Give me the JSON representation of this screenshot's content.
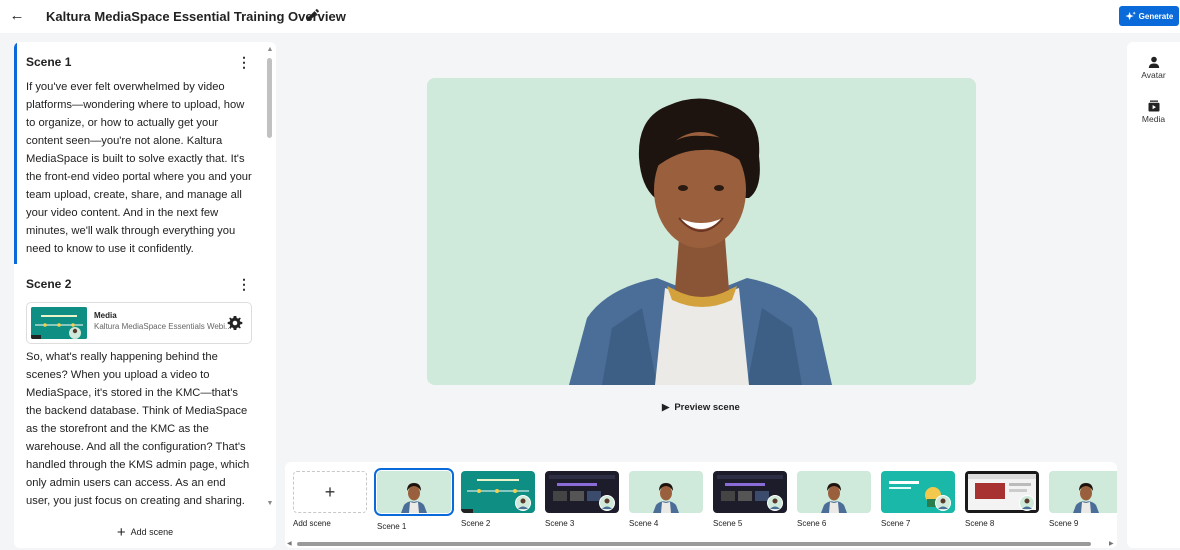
{
  "header": {
    "title": "Kaltura MediaSpace Essential Training Overview",
    "back_icon": "arrow-left-icon",
    "edit_icon": "pencil-icon",
    "generate_label": "Generate"
  },
  "script": {
    "scenes": [
      {
        "name": "Scene 1",
        "text": "If you've ever felt overwhelmed by video platforms—wondering where to upload, how to organize, or how to actually get your content seen—you're not alone. Kaltura MediaSpace is built to solve exactly that. It's the front-end video portal where you and your team upload, create, share, and manage all your video content. And in the next few minutes, we'll walk through everything you need to know to use it confidently."
      },
      {
        "name": "Scene 2",
        "media_title": "Media",
        "media_subtitle": "Kaltura MediaSpace Essentials Webi...",
        "text": "So, what's really happening behind the scenes? When you upload a video to MediaSpace, it's stored in the KMC—that's the backend database. Think of MediaSpace as the storefront and the KMC as the warehouse. And all the configuration? That's handled through the KMS admin page, which only admin users can access. As an end user, you just focus on creating and sharing. The platform itself can be set up for internal use"
      }
    ],
    "add_scene_label": "Add scene"
  },
  "stage": {
    "preview_label": "Preview scene",
    "background_color": "#cfe9da"
  },
  "right_bar": {
    "tools": [
      {
        "label": "Avatar",
        "icon": "person-icon"
      },
      {
        "label": "Media",
        "icon": "media-icon"
      }
    ]
  },
  "timeline": {
    "add_label": "Add scene",
    "scenes": [
      {
        "label": "Scene 1",
        "kind": "avatar"
      },
      {
        "label": "Scene 2",
        "kind": "slide-teal"
      },
      {
        "label": "Scene 3",
        "kind": "dark-screen"
      },
      {
        "label": "Scene 4",
        "kind": "avatar"
      },
      {
        "label": "Scene 5",
        "kind": "dark-screen"
      },
      {
        "label": "Scene 6",
        "kind": "avatar"
      },
      {
        "label": "Scene 7",
        "kind": "slide-teal-bright"
      },
      {
        "label": "Scene 8",
        "kind": "browser"
      },
      {
        "label": "Scene 9",
        "kind": "avatar"
      }
    ]
  },
  "colors": {
    "accent": "#0a6ad9",
    "stage_green": "#cfe9da",
    "teal": "#0f8f83"
  }
}
